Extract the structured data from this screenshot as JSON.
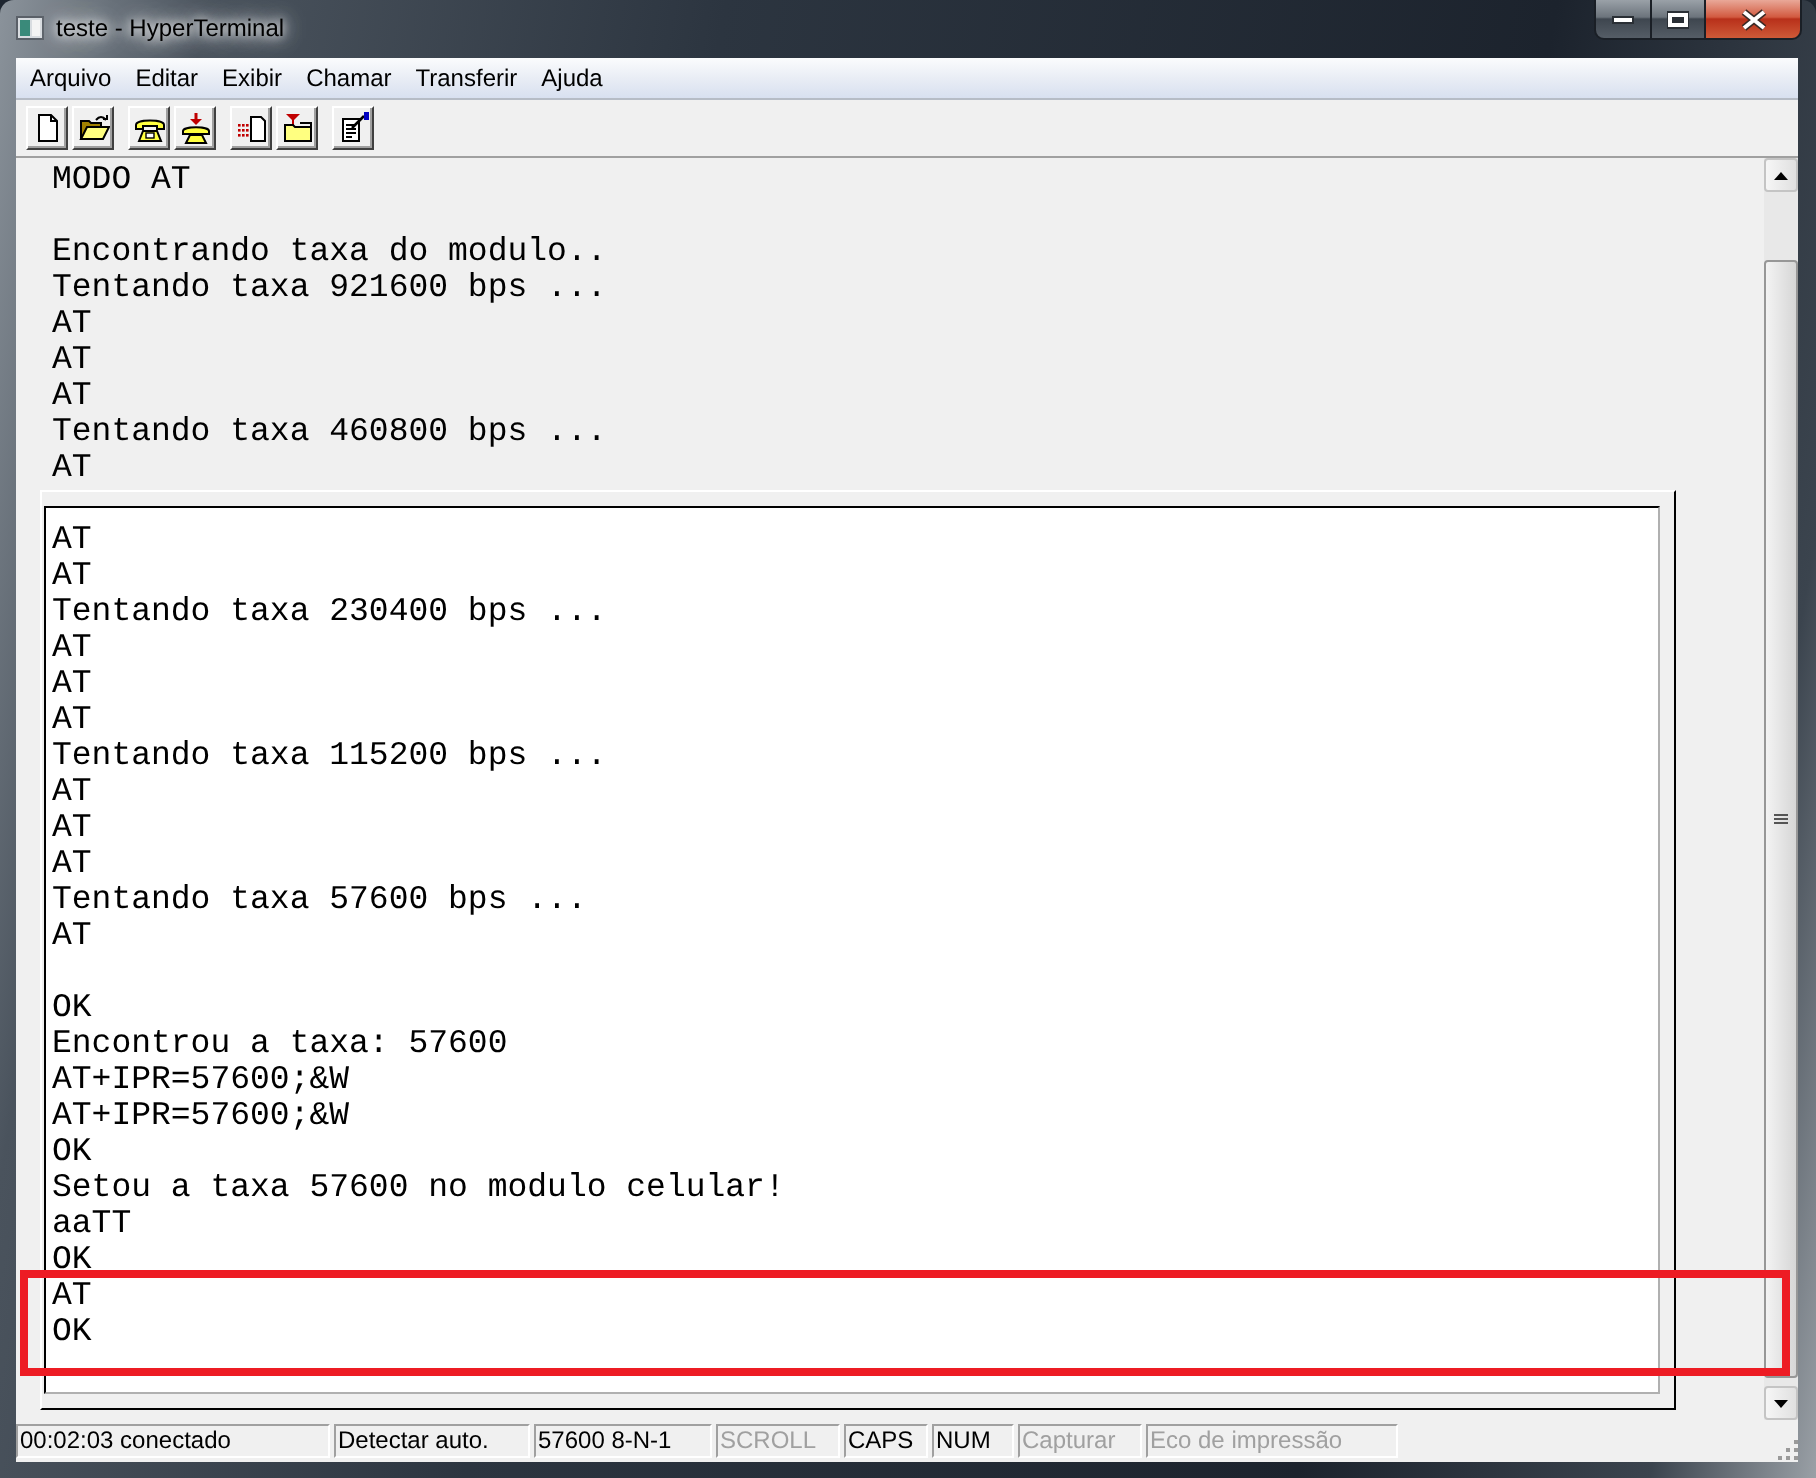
{
  "window": {
    "title": "teste - HyperTerminal"
  },
  "menu": [
    "Arquivo",
    "Editar",
    "Exibir",
    "Chamar",
    "Transferir",
    "Ajuda"
  ],
  "terminal": {
    "top_blocks": [
      [
        "MODO AT"
      ],
      [
        "Encontrando taxa do modulo..",
        "Tentando taxa 921600 bps ...",
        "AT",
        "AT",
        "AT",
        "Tentando taxa 460800 bps ...",
        "AT"
      ]
    ],
    "panel_blocks": [
      [
        {
          "text": "AT",
          "highlighted": false
        },
        {
          "text": "AT",
          "highlighted": false
        },
        {
          "text": "Tentando taxa 230400 bps ...",
          "highlighted": false
        },
        {
          "text": "AT",
          "highlighted": false
        },
        {
          "text": "AT",
          "highlighted": false
        },
        {
          "text": "AT",
          "highlighted": false
        },
        {
          "text": "Tentando taxa 115200 bps ...",
          "highlighted": false
        },
        {
          "text": "AT",
          "highlighted": false
        },
        {
          "text": "AT",
          "highlighted": false
        },
        {
          "text": "AT",
          "highlighted": false
        },
        {
          "text": "Tentando taxa 57600 bps ...",
          "highlighted": false
        },
        {
          "text": "AT",
          "highlighted": false
        }
      ],
      [
        {
          "text": "OK",
          "highlighted": false
        },
        {
          "text": "Encontrou a taxa: 57600",
          "highlighted": false
        },
        {
          "text": "AT+IPR=57600;&W",
          "highlighted": false
        },
        {
          "text": "AT+IPR=57600;&W",
          "highlighted": false
        },
        {
          "text": "OK",
          "highlighted": false
        },
        {
          "text": "Setou a taxa 57600 no modulo celular!",
          "highlighted": false
        },
        {
          "text": "aaTT",
          "highlighted": false
        },
        {
          "text": "OK",
          "highlighted": false
        },
        {
          "text": "AT",
          "highlighted": true
        },
        {
          "text": "OK",
          "highlighted": true
        }
      ]
    ]
  },
  "status_bar": [
    {
      "text": "00:02:03 conectado",
      "disabled": false
    },
    {
      "text": "Detectar auto.",
      "disabled": false
    },
    {
      "text": "57600 8-N-1",
      "disabled": false
    },
    {
      "text": "SCROLL",
      "disabled": true
    },
    {
      "text": "CAPS",
      "disabled": false
    },
    {
      "text": "NUM",
      "disabled": false
    },
    {
      "text": "Capturar",
      "disabled": true
    },
    {
      "text": "Eco de impressão",
      "disabled": true
    }
  ]
}
